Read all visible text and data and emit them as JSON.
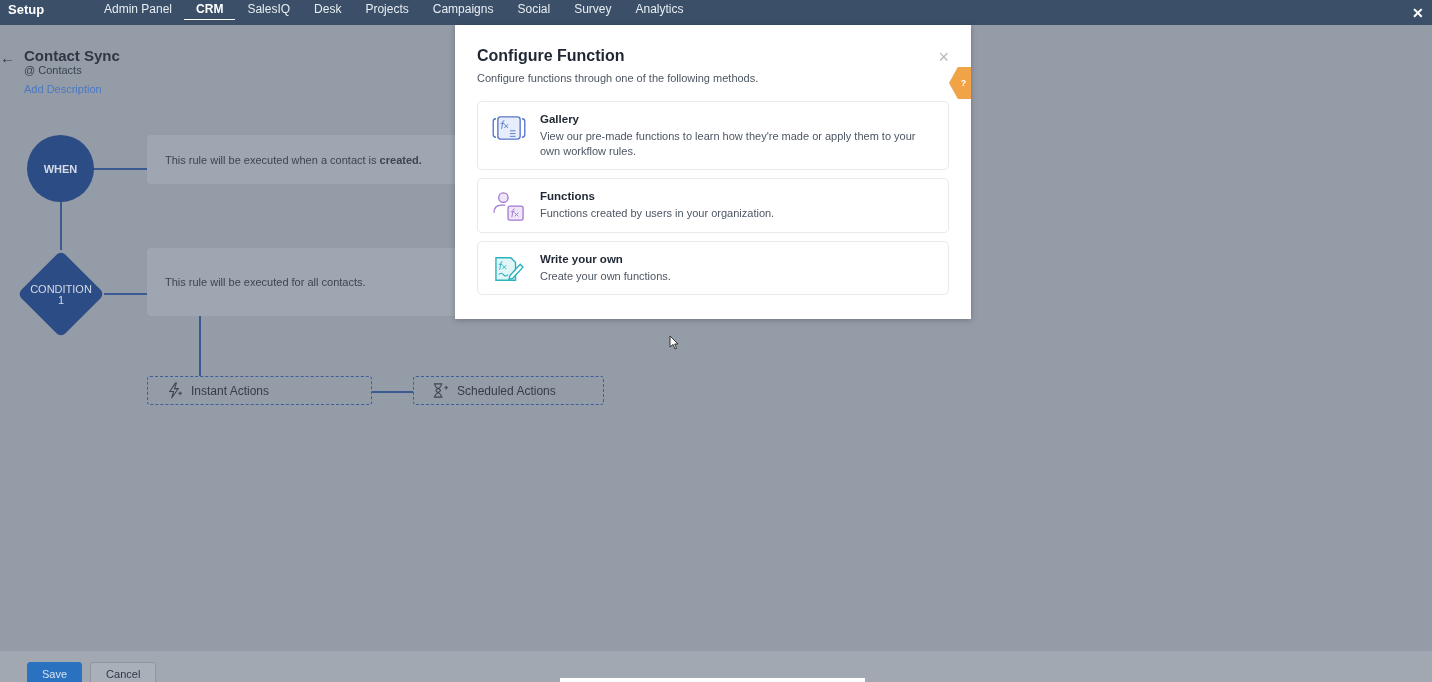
{
  "nav": {
    "title": "Setup",
    "tabs": [
      {
        "label": "Admin Panel",
        "selected": false
      },
      {
        "label": "CRM",
        "selected": true
      },
      {
        "label": "SalesIQ",
        "selected": false
      },
      {
        "label": "Desk",
        "selected": false
      },
      {
        "label": "Projects",
        "selected": false
      },
      {
        "label": "Campaigns",
        "selected": false
      },
      {
        "label": "Social",
        "selected": false
      },
      {
        "label": "Survey",
        "selected": false
      },
      {
        "label": "Analytics",
        "selected": false
      }
    ],
    "close": "✕"
  },
  "rule": {
    "back": "←",
    "title": "Contact Sync",
    "module": "@ Contacts",
    "add_description": "Add Description"
  },
  "flow": {
    "when": {
      "label": "WHEN",
      "text": "This rule will be executed when a contact is **created.**"
    },
    "condition": {
      "label": "CONDITION",
      "number": "1",
      "text": "This rule will be executed for all contacts."
    },
    "actions": [
      {
        "kind": "instant",
        "label": "Instant Actions"
      },
      {
        "kind": "scheduled",
        "label": "Scheduled Actions"
      }
    ]
  },
  "dialog": {
    "title": "Configure Function",
    "subtitle": "Configure functions through one of the following methods.",
    "close": "×",
    "help": "?",
    "options": [
      {
        "kind": "gallery",
        "title": "Gallery",
        "description": "View our pre-made functions to learn how they're made or apply them to your own workflow rules."
      },
      {
        "kind": "functions",
        "title": "Functions",
        "description": "Functions created by users in your organization."
      },
      {
        "kind": "write",
        "title": "Write your own",
        "description": "Create your own functions."
      }
    ]
  },
  "footer": {
    "buttons": [
      {
        "kind": "primary",
        "label": "Save"
      },
      {
        "kind": "secondary",
        "label": "Cancel"
      }
    ]
  }
}
